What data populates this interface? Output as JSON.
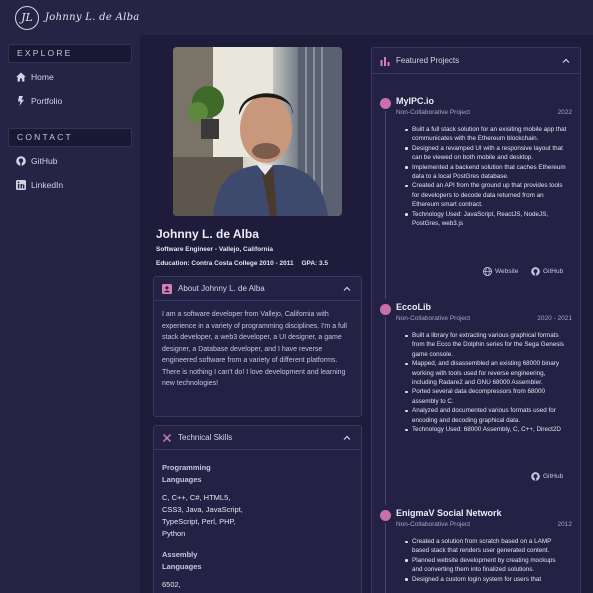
{
  "header": {
    "logo_mark": "JL",
    "logo_text": "Johnny L. de Alba"
  },
  "sidebar": {
    "explore_heading": "EXPLORE",
    "explore_items": [
      {
        "label": "Home",
        "icon": "home-icon"
      },
      {
        "label": "Portfolio",
        "icon": "bolt-icon"
      }
    ],
    "contact_heading": "CONTACT",
    "contact_items": [
      {
        "label": "GitHub",
        "icon": "github-icon"
      },
      {
        "label": "LinkedIn",
        "icon": "linkedin-icon"
      }
    ]
  },
  "profile": {
    "name": "Johnny L. de Alba",
    "title_line": "Software Engineer - Vallejo, California",
    "education_line": "Education: Contra Costa College 2010 - 2011",
    "gpa": "GPA: 3.5"
  },
  "about": {
    "heading": "About Johnny L. de Alba",
    "text": "I am a software developer from Vallejo, California with experience in a variety of programming disciplines. I'm a full stack developer, a web3 developer, a UI designer, a game designer, a Database developer, and I have reverse engineered software from a variety of different platforms. There is nothing I can't do! I love development and learning new technologies!"
  },
  "skills": {
    "heading": "Technical Skills",
    "groups": [
      {
        "title_1": "Programming",
        "title_2": "Languages",
        "values": [
          "C, C++, C#, HTML5,",
          "CSS3, Java, JavaScript,",
          "TypeScript, Perl, PHP,",
          "Python"
        ]
      },
      {
        "title_1": "Assembly",
        "title_2": "Languages",
        "values": [
          "6502,"
        ]
      }
    ]
  },
  "projects": {
    "heading": "Featured Projects",
    "items": [
      {
        "title": "MyIPC.io",
        "type": "Non-Collaborative Project",
        "year": "2022",
        "bullets": [
          "Built a full stack solution for an exisiting mobile app that communicates with the Ethereum blockchain.",
          "Designed a revamped UI with a responsive layout that can be viewed on both mobile and desktop.",
          "Implemented a backend solution that caches Ethereum data to a local PostGres database.",
          "Created an API from the ground up that provides tools for developers to decode data returned from an Ethereum smart contract.",
          "Technology Used: JavaScript, ReactJS, NodeJS, PostGres, web3.js"
        ],
        "links": [
          "Website",
          "GitHub"
        ]
      },
      {
        "title": "EccoLib",
        "type": "Non-Collaborative Project",
        "year": "2020 - 2021",
        "bullets": [
          "Built a library for extracting various graphical formats from the Ecco the Dolphin series for the Sega Genesis game console.",
          "Mapped, and disassembled an existing 68000 binary working with tools used for reverse engineering, including Radare2 and GNU 68000 Assembler.",
          "Ported several data decompressors from 68000 assembly to C.",
          "Analyzed and documented various formats used for encoding and decoding graphical data.",
          "Technology Used: 68000 Assembly, C, C++, Direct2D"
        ],
        "links": [
          "GitHub"
        ]
      },
      {
        "title": "EnigmaV Social Network",
        "type": "Non-Collaborative Project",
        "year": "2012",
        "bullets": [
          "Created a solution from scratch based on a LAMP based stack that renders user generated content.",
          "Planned website development by creating mockups and converting them into finalized solutions.",
          "Designed a custom login system for users that"
        ],
        "links": []
      }
    ]
  },
  "colors": {
    "background": "#1e1c3a",
    "panel": "#262445",
    "accent": "#c672a9"
  }
}
